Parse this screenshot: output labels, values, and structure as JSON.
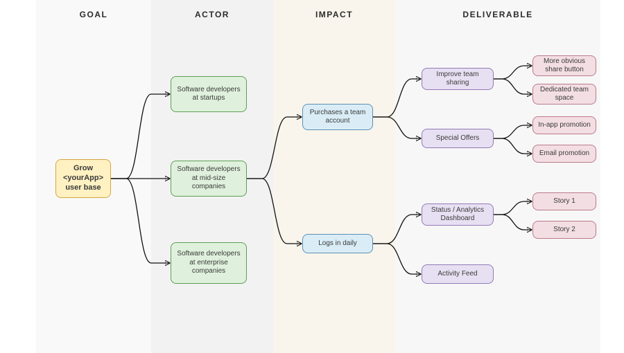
{
  "columns": {
    "goal": "GOAL",
    "actor": "ACTOR",
    "impact": "IMPACT",
    "deliverable": "DELIVERABLE"
  },
  "goal": {
    "label": "Grow <yourApp> user base"
  },
  "actors": [
    {
      "label": "Software developers at startups"
    },
    {
      "label": "Software developers at mid-size companies"
    },
    {
      "label": "Software developers at enterprise companies"
    }
  ],
  "impacts": [
    {
      "label": "Purchases a team account"
    },
    {
      "label": "Logs in daily"
    }
  ],
  "deliverables": [
    {
      "label": "Improve team sharing"
    },
    {
      "label": "Special Offers"
    },
    {
      "label": "Status / Analytics Dashboard"
    },
    {
      "label": "Activity Feed"
    }
  ],
  "stories": [
    {
      "label": "More obvious share button"
    },
    {
      "label": "Dedicated team space"
    },
    {
      "label": "In-app promotion"
    },
    {
      "label": "Email promotion"
    },
    {
      "label": "Story 1"
    },
    {
      "label": "Story 2"
    }
  ],
  "colors": {
    "goal_bg": "#fff1c2",
    "goal_border": "#d3a63e",
    "actor_bg": "#dff1dc",
    "actor_border": "#5a9e55",
    "impact_bg": "#daedf7",
    "impact_border": "#5a8fb5",
    "deliverable_bg": "#e7e0f2",
    "deliverable_border": "#9279b6",
    "story_bg": "#f3dee4",
    "story_border": "#b97a8a"
  }
}
